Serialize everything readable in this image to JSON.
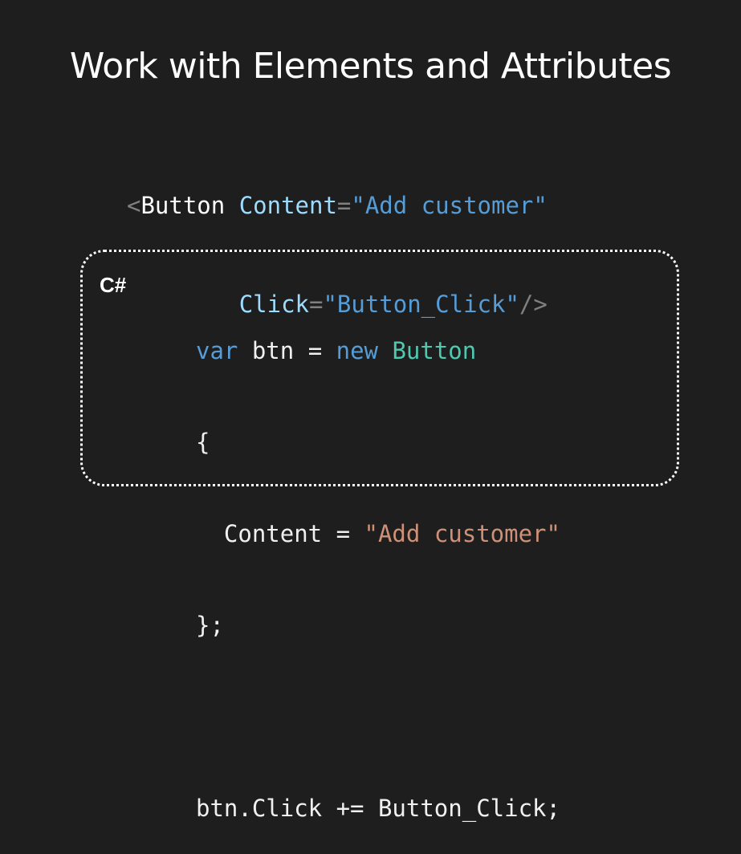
{
  "slide": {
    "title": "Work with Elements and Attributes"
  },
  "xaml": {
    "line1": {
      "open": "<",
      "tag": "Button",
      "attr1": "Content",
      "eq1": "=",
      "val1": "\"Add customer\""
    },
    "line2": {
      "attr2": "Click",
      "eq2": "=",
      "val2": "\"Button_Click\"",
      "close": "/>"
    }
  },
  "csharp": {
    "label": "C#",
    "line1": {
      "kw_var": "var",
      "name": " btn = ",
      "kw_new": "new",
      "type": "Button"
    },
    "line2": "{",
    "line3": {
      "prop": "  Content = ",
      "str": "\"Add customer\""
    },
    "line4": "};",
    "line5": "",
    "line6": "btn.Click += Button_Click;"
  },
  "colors": {
    "background": "#1e1e1e",
    "attribute": "#9cdcfe",
    "string_xaml": "#569cd6",
    "keyword": "#569cd6",
    "type": "#4ec9b0",
    "string_csharp": "#ce9178"
  }
}
